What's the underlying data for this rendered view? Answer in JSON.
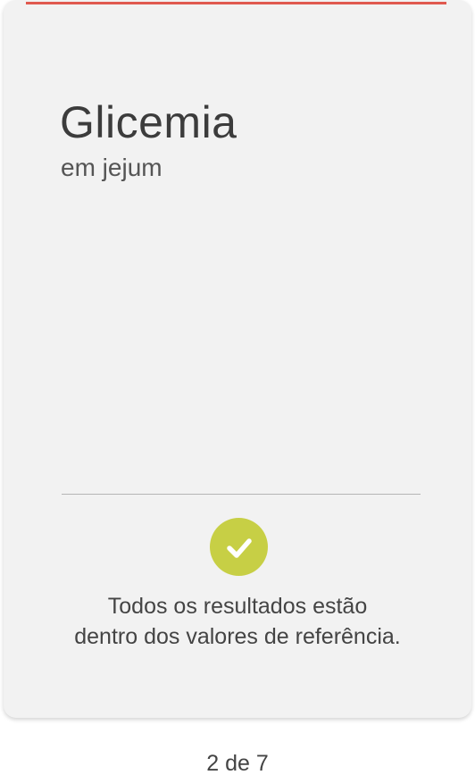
{
  "card": {
    "title": "Glicemia",
    "subtitle": "em jejum",
    "accent_color": "#e05a4f",
    "status": {
      "icon": "check-icon",
      "icon_color": "#c7cf45",
      "line1": "Todos os resultados estão",
      "line2": "dentro dos valores de referência."
    }
  },
  "pager": {
    "label": "2 de 7"
  }
}
